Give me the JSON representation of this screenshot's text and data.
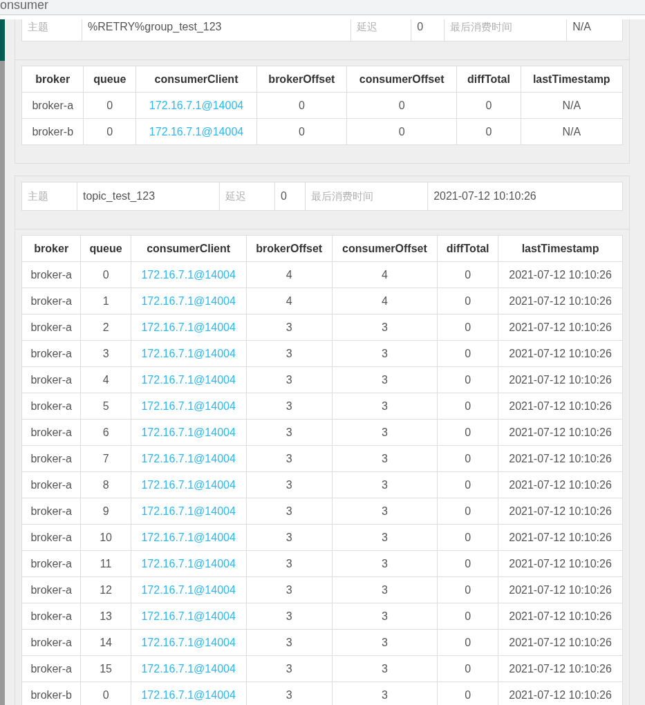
{
  "header": {
    "title": "onsumer"
  },
  "groups": [
    {
      "info": {
        "topic_label": "主题",
        "topic": "%RETRY%group_test_123",
        "delay_label": "延迟",
        "delay": "0",
        "last_label": "最后消费时间",
        "last": "N/A"
      },
      "columns": [
        "broker",
        "queue",
        "consumerClient",
        "brokerOffset",
        "consumerOffset",
        "diffTotal",
        "lastTimestamp"
      ],
      "rows": [
        {
          "broker": "broker-a",
          "queue": "0",
          "client": "172.16.7.1@14004",
          "brokerOffset": "0",
          "consumerOffset": "0",
          "diffTotal": "0",
          "lastTimestamp": "N/A"
        },
        {
          "broker": "broker-b",
          "queue": "0",
          "client": "172.16.7.1@14004",
          "brokerOffset": "0",
          "consumerOffset": "0",
          "diffTotal": "0",
          "lastTimestamp": "N/A"
        }
      ]
    },
    {
      "info": {
        "topic_label": "主题",
        "topic": "topic_test_123",
        "delay_label": "延迟",
        "delay": "0",
        "last_label": "最后消费时间",
        "last": "2021-07-12 10:10:26"
      },
      "columns": [
        "broker",
        "queue",
        "consumerClient",
        "brokerOffset",
        "consumerOffset",
        "diffTotal",
        "lastTimestamp"
      ],
      "rows": [
        {
          "broker": "broker-a",
          "queue": "0",
          "client": "172.16.7.1@14004",
          "brokerOffset": "4",
          "consumerOffset": "4",
          "diffTotal": "0",
          "lastTimestamp": "2021-07-12 10:10:26"
        },
        {
          "broker": "broker-a",
          "queue": "1",
          "client": "172.16.7.1@14004",
          "brokerOffset": "4",
          "consumerOffset": "4",
          "diffTotal": "0",
          "lastTimestamp": "2021-07-12 10:10:26"
        },
        {
          "broker": "broker-a",
          "queue": "2",
          "client": "172.16.7.1@14004",
          "brokerOffset": "3",
          "consumerOffset": "3",
          "diffTotal": "0",
          "lastTimestamp": "2021-07-12 10:10:26"
        },
        {
          "broker": "broker-a",
          "queue": "3",
          "client": "172.16.7.1@14004",
          "brokerOffset": "3",
          "consumerOffset": "3",
          "diffTotal": "0",
          "lastTimestamp": "2021-07-12 10:10:26"
        },
        {
          "broker": "broker-a",
          "queue": "4",
          "client": "172.16.7.1@14004",
          "brokerOffset": "3",
          "consumerOffset": "3",
          "diffTotal": "0",
          "lastTimestamp": "2021-07-12 10:10:26"
        },
        {
          "broker": "broker-a",
          "queue": "5",
          "client": "172.16.7.1@14004",
          "brokerOffset": "3",
          "consumerOffset": "3",
          "diffTotal": "0",
          "lastTimestamp": "2021-07-12 10:10:26"
        },
        {
          "broker": "broker-a",
          "queue": "6",
          "client": "172.16.7.1@14004",
          "brokerOffset": "3",
          "consumerOffset": "3",
          "diffTotal": "0",
          "lastTimestamp": "2021-07-12 10:10:26"
        },
        {
          "broker": "broker-a",
          "queue": "7",
          "client": "172.16.7.1@14004",
          "brokerOffset": "3",
          "consumerOffset": "3",
          "diffTotal": "0",
          "lastTimestamp": "2021-07-12 10:10:26"
        },
        {
          "broker": "broker-a",
          "queue": "8",
          "client": "172.16.7.1@14004",
          "brokerOffset": "3",
          "consumerOffset": "3",
          "diffTotal": "0",
          "lastTimestamp": "2021-07-12 10:10:26"
        },
        {
          "broker": "broker-a",
          "queue": "9",
          "client": "172.16.7.1@14004",
          "brokerOffset": "3",
          "consumerOffset": "3",
          "diffTotal": "0",
          "lastTimestamp": "2021-07-12 10:10:26"
        },
        {
          "broker": "broker-a",
          "queue": "10",
          "client": "172.16.7.1@14004",
          "brokerOffset": "3",
          "consumerOffset": "3",
          "diffTotal": "0",
          "lastTimestamp": "2021-07-12 10:10:26"
        },
        {
          "broker": "broker-a",
          "queue": "11",
          "client": "172.16.7.1@14004",
          "brokerOffset": "3",
          "consumerOffset": "3",
          "diffTotal": "0",
          "lastTimestamp": "2021-07-12 10:10:26"
        },
        {
          "broker": "broker-a",
          "queue": "12",
          "client": "172.16.7.1@14004",
          "brokerOffset": "3",
          "consumerOffset": "3",
          "diffTotal": "0",
          "lastTimestamp": "2021-07-12 10:10:26"
        },
        {
          "broker": "broker-a",
          "queue": "13",
          "client": "172.16.7.1@14004",
          "brokerOffset": "3",
          "consumerOffset": "3",
          "diffTotal": "0",
          "lastTimestamp": "2021-07-12 10:10:26"
        },
        {
          "broker": "broker-a",
          "queue": "14",
          "client": "172.16.7.1@14004",
          "brokerOffset": "3",
          "consumerOffset": "3",
          "diffTotal": "0",
          "lastTimestamp": "2021-07-12 10:10:26"
        },
        {
          "broker": "broker-a",
          "queue": "15",
          "client": "172.16.7.1@14004",
          "brokerOffset": "3",
          "consumerOffset": "3",
          "diffTotal": "0",
          "lastTimestamp": "2021-07-12 10:10:26"
        },
        {
          "broker": "broker-b",
          "queue": "0",
          "client": "172.16.7.1@14004",
          "brokerOffset": "3",
          "consumerOffset": "3",
          "diffTotal": "0",
          "lastTimestamp": "2021-07-12 10:10:26"
        }
      ]
    }
  ]
}
